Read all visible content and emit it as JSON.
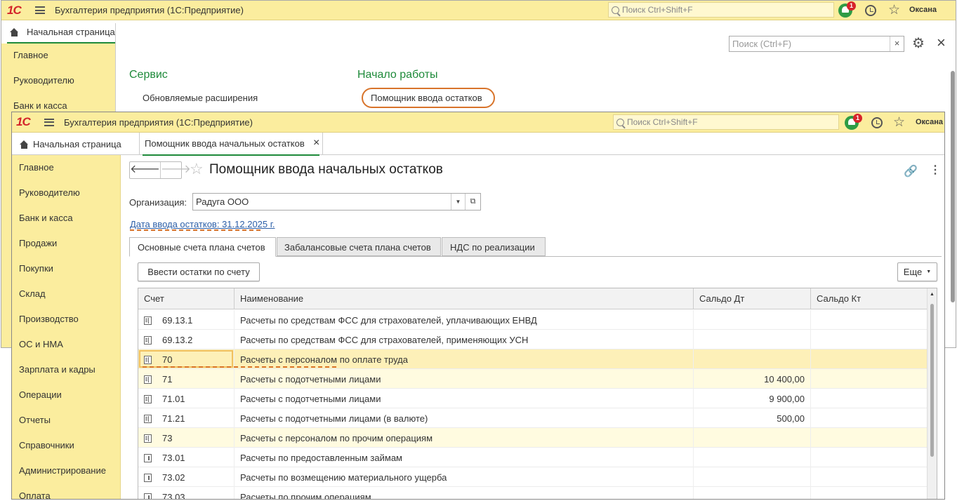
{
  "back_window": {
    "app_title": "Бухгалтерия предприятия  (1С:Предприятие)",
    "logo": "1С",
    "global_search_placeholder": "Поиск Ctrl+Shift+F",
    "notifications_count": "1",
    "user": "Оксана",
    "home_tab": "Начальная страница",
    "sidebar": [
      "Главное",
      "Руководителю",
      "Банк и касса"
    ],
    "search_placeholder": "Поиск (Ctrl+F)",
    "clear_label": "×",
    "close_label": "×",
    "section_service": "Сервис",
    "section_start": "Начало работы",
    "link_extensions": "Обновляемые расширения",
    "link_assistant": "Помощник ввода остатков"
  },
  "front_window": {
    "app_title": "Бухгалтерия предприятия  (1С:Предприятие)",
    "logo": "1С",
    "global_search_placeholder": "Поиск Ctrl+Shift+F",
    "notifications_count": "1",
    "user": "Оксана",
    "tabs": {
      "home": "Начальная страница",
      "active": "Помощник ввода начальных остатков",
      "close": "×"
    },
    "sidebar": [
      "Главное",
      "Руководителю",
      "Банк и касса",
      "Продажи",
      "Покупки",
      "Склад",
      "Производство",
      "ОС и НМА",
      "Зарплата и кадры",
      "Операции",
      "Отчеты",
      "Справочники",
      "Администрирование",
      "Оплата"
    ],
    "form": {
      "title": "Помощник ввода начальных остатков",
      "org_label": "Организация:",
      "org_value": "Радуга ООО",
      "date_link": "Дата ввода остатков: 31.12.2025 г.",
      "subtabs": [
        "Основные счета плана счетов",
        "Забалансовые счета плана счетов",
        "НДС по реализации"
      ],
      "enter_button": "Ввести остатки по счету",
      "more_button": "Еще",
      "columns": [
        "Счет",
        "Наименование",
        "Сальдо Дт",
        "Сальдо Кт"
      ],
      "rows": [
        {
          "account": "69.13.1",
          "name": "Расчеты по средствам ФСС для страхователей, уплачивающих ЕНВД",
          "debit": "",
          "credit": "",
          "group": true
        },
        {
          "account": "69.13.2",
          "name": "Расчеты по средствам ФСС для страхователей, применяющих УСН",
          "debit": "",
          "credit": "",
          "group": true
        },
        {
          "account": "70",
          "name": "Расчеты с персоналом по оплате труда",
          "debit": "",
          "credit": "",
          "group": true
        },
        {
          "account": "71",
          "name": "Расчеты с подотчетными лицами",
          "debit": "10 400,00",
          "credit": "",
          "group": true
        },
        {
          "account": "71.01",
          "name": "Расчеты с подотчетными лицами",
          "debit": "9 900,00",
          "credit": "",
          "group": true
        },
        {
          "account": "71.21",
          "name": "Расчеты с подотчетными лицами (в валюте)",
          "debit": "500,00",
          "credit": "",
          "group": true
        },
        {
          "account": "73",
          "name": "Расчеты с персоналом по прочим операциям",
          "debit": "",
          "credit": "",
          "group": true
        },
        {
          "account": "73.01",
          "name": "Расчеты по предоставленным займам",
          "debit": "",
          "credit": "",
          "group": false
        },
        {
          "account": "73.02",
          "name": "Расчеты по возмещению материального ущерба",
          "debit": "",
          "credit": "",
          "group": false
        },
        {
          "account": "73.03",
          "name": "Расчеты по прочим операциям",
          "debit": "",
          "credit": "",
          "group": false
        }
      ]
    }
  },
  "colors": {
    "topbar": "#fbed9e",
    "accent_green": "#1e8a3a",
    "highlight_orange": "#d8742b",
    "selected_row": "#fdf0b8",
    "highlight_row": "#fffbe0"
  }
}
